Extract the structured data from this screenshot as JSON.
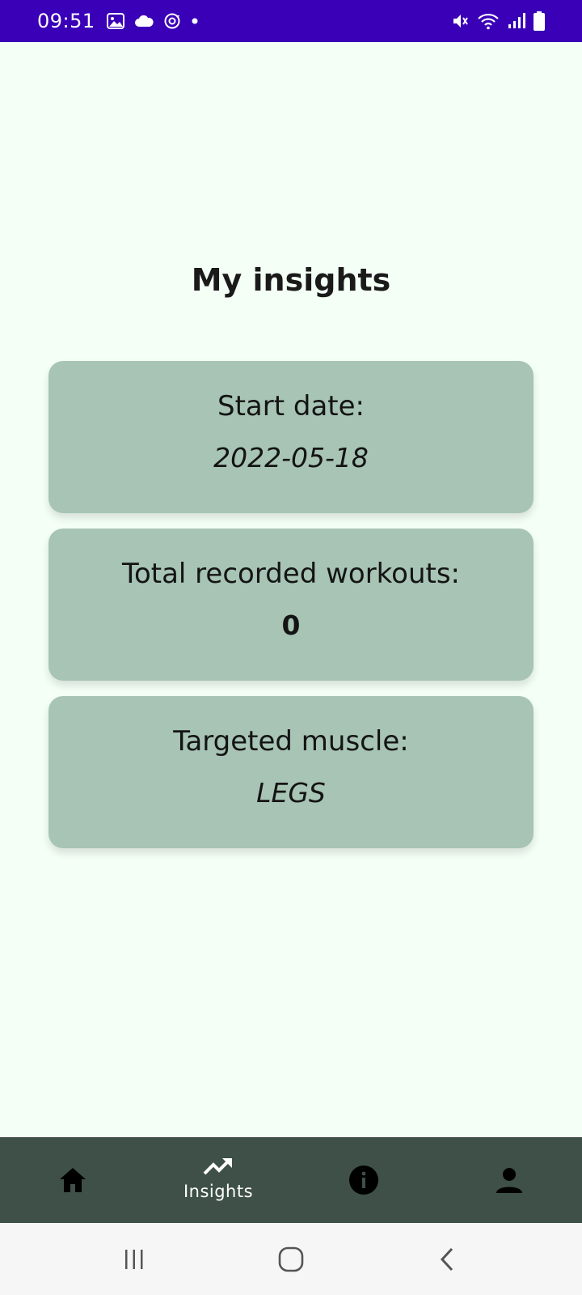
{
  "status_bar": {
    "time": "09:51",
    "left_icons": [
      "image-icon",
      "cloud-icon",
      "sync-icon",
      "dot-icon"
    ],
    "right_icons": [
      "mute-icon",
      "wifi-icon",
      "signal-icon",
      "battery-icon"
    ]
  },
  "page": {
    "title": "My insights"
  },
  "cards": [
    {
      "label": "Start date:",
      "value": "2022-05-18"
    },
    {
      "label": "Total recorded workouts:",
      "value": "0"
    },
    {
      "label": "Targeted muscle:",
      "value": "LEGS"
    }
  ],
  "bottom_nav": {
    "items": [
      {
        "icon": "home-icon",
        "label": ""
      },
      {
        "icon": "trending-up-icon",
        "label": "Insights",
        "active": true
      },
      {
        "icon": "info-icon",
        "label": ""
      },
      {
        "icon": "person-icon",
        "label": ""
      }
    ]
  },
  "system_nav": {
    "buttons": [
      "recents-icon",
      "home-circle-icon",
      "back-icon"
    ]
  },
  "colors": {
    "status_bar": "#3a00b8",
    "background": "#f4fff6",
    "card": "#a7c4b5",
    "bottom_nav": "#3e5048",
    "system_nav": "#f6f6f6"
  }
}
